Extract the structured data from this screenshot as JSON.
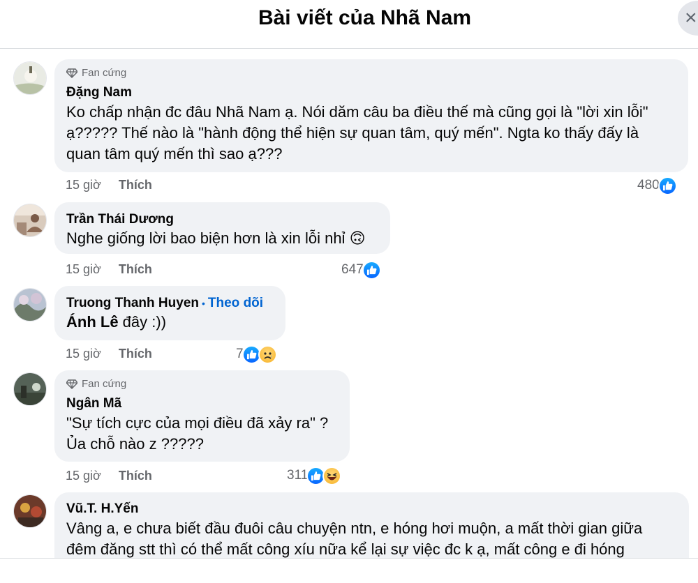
{
  "header": {
    "title": "Bài viết của Nhã Nam",
    "close_symbol": "×"
  },
  "colors": {
    "accent": "#0064d1",
    "bubble": "#f0f2f5",
    "like": "#0866ff",
    "meta": "#65676b"
  },
  "comments": [
    {
      "badge": "Fan cứng",
      "author": "Đặng Nam",
      "text": "Ko chấp nhận đc đâu Nhã Nam ạ. Nói dăm câu ba điều thế mà cũng gọi là \"lời xin lỗi\"\nạ????? Thế nào là \"hành động thể hiện sự quan tâm, quý mến\". Ngta ko thấy đấy là\nquan tâm quý mến thì sao ạ???",
      "time": "15 giờ",
      "like_label": "Thích",
      "reaction_count": "480",
      "reactions": [
        "like-icon"
      ]
    },
    {
      "author": "Trần Thái Dương",
      "text": "Nghe giống lời bao biện hơn là xin lỗi nhỉ",
      "emoji": "🙃",
      "time": "15 giờ",
      "like_label": "Thích",
      "reaction_count": "647",
      "reactions": [
        "like-icon"
      ]
    },
    {
      "author": "Truong Thanh Huyen",
      "follow_label": "Theo dõi",
      "mention": "Ánh Lê",
      "text": " đây :))",
      "time": "15 giờ",
      "like_label": "Thích",
      "reaction_count": "7",
      "reactions": [
        "like-icon",
        "sad-icon"
      ]
    },
    {
      "badge": "Fan cứng",
      "author": "Ngân Mã",
      "text": "\"Sự tích cực của mọi điều đã xảy ra\" ?\nỦa chỗ nào z ?????",
      "time": "15 giờ",
      "like_label": "Thích",
      "reaction_count": "311",
      "reactions": [
        "like-icon",
        "haha-icon"
      ]
    },
    {
      "author": "Vũ.T. H.Yến",
      "text": "Vâng a, e chưa biết đầu đuôi câu chuyện ntn, e hóng hơi muộn, a mất thời gian giữa\nđêm đăng stt thì có thể mất công xíu nữa kể lại sự việc đc k ạ, mất công e đi hóng"
    }
  ]
}
